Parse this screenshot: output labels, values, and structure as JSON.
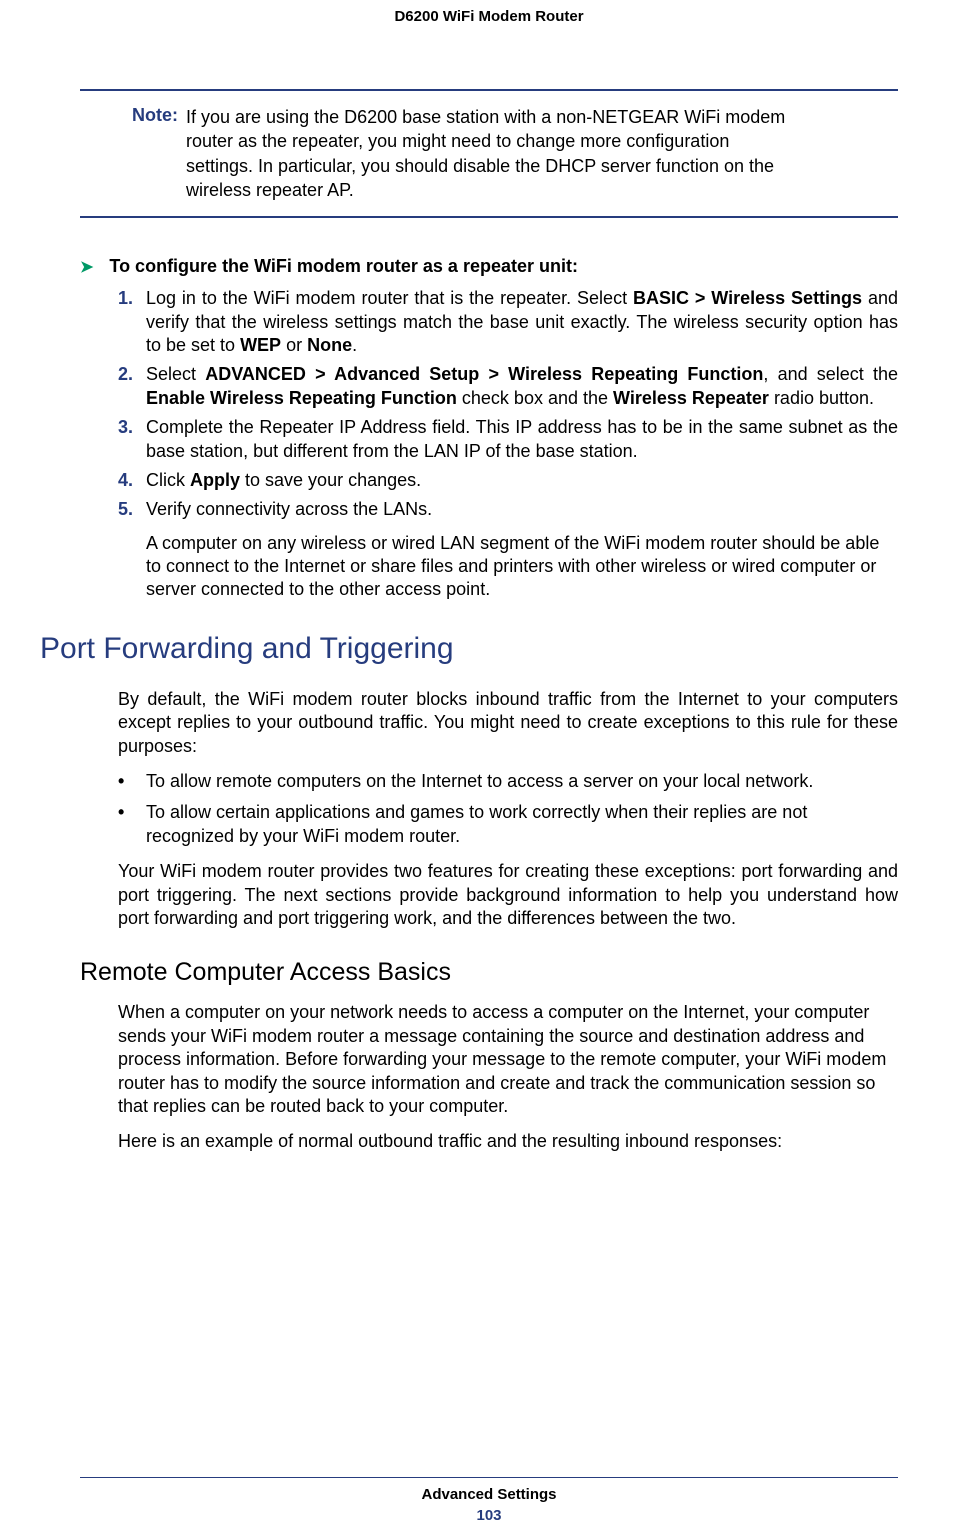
{
  "header": {
    "title": "D6200 WiFi Modem Router"
  },
  "note": {
    "label": "Note:",
    "text": "If you are using the D6200 base station with a non-NETGEAR WiFi modem router as the repeater, you might need to change more configuration settings. In particular, you should disable the DHCP server function on the wireless repeater AP."
  },
  "procedure": {
    "arrow": "➤",
    "title": "To configure the WiFi modem router as a repeater unit:",
    "steps": [
      {
        "num": "1.",
        "pre": "Log in to the WiFi modem router that is the repeater. Select ",
        "b1": "BASIC > Wireless Settings",
        "mid": " and verify that the wireless settings match the base unit exactly. The wireless security option has to be set to ",
        "b2": "WEP",
        "mid2": " or ",
        "b3": "None",
        "post": "."
      },
      {
        "num": "2.",
        "pre": "Select ",
        "b1": "ADVANCED > Advanced Setup > Wireless Repeating Function",
        "mid": ", and select the ",
        "b2": "Enable Wireless Repeating Function",
        "mid2": " check box and the ",
        "b3": "Wireless Repeater",
        "post": " radio button."
      },
      {
        "num": "3.",
        "text": "Complete the Repeater IP Address field. This IP address has to be in the same subnet as the base station, but different from the LAN IP of the base station."
      },
      {
        "num": "4.",
        "pre": "Click ",
        "b1": "Apply",
        "post": " to save your changes."
      },
      {
        "num": "5.",
        "text": "Verify connectivity across the LANs."
      }
    ],
    "subtext": "A computer on any wireless or wired LAN segment of the WiFi modem router should be able to connect to the Internet or share files and printers with other wireless or wired computer or server connected to the other access point."
  },
  "section1": {
    "heading": "Port Forwarding and Triggering",
    "para1": "By default, the WiFi modem router blocks inbound traffic from the Internet to your computers except replies to your outbound traffic. You might need to create exceptions to this rule for these purposes:",
    "bullets": [
      "To allow remote computers on the Internet to access a server on your local network.",
      "To allow certain applications and games to work correctly when their replies are not recognized by your WiFi modem router."
    ],
    "bullet_dot": "•",
    "para2": "Your WiFi modem router provides two features for creating these exceptions: port forwarding and port triggering. The next sections provide background information to help you understand how port forwarding and port triggering work, and the differences between the two."
  },
  "section2": {
    "heading": "Remote Computer Access Basics",
    "para1": "When a computer on your network needs to access a computer on the Internet, your computer sends your WiFi modem router a message containing the source and destination address and process information. Before forwarding your message to the remote computer, your WiFi modem router has to modify the source information and create and track the communication session so that replies can be routed back to your computer.",
    "para2": "Here is an example of normal outbound traffic and the resulting inbound responses:"
  },
  "footer": {
    "title": "Advanced Settings",
    "page": "103"
  }
}
